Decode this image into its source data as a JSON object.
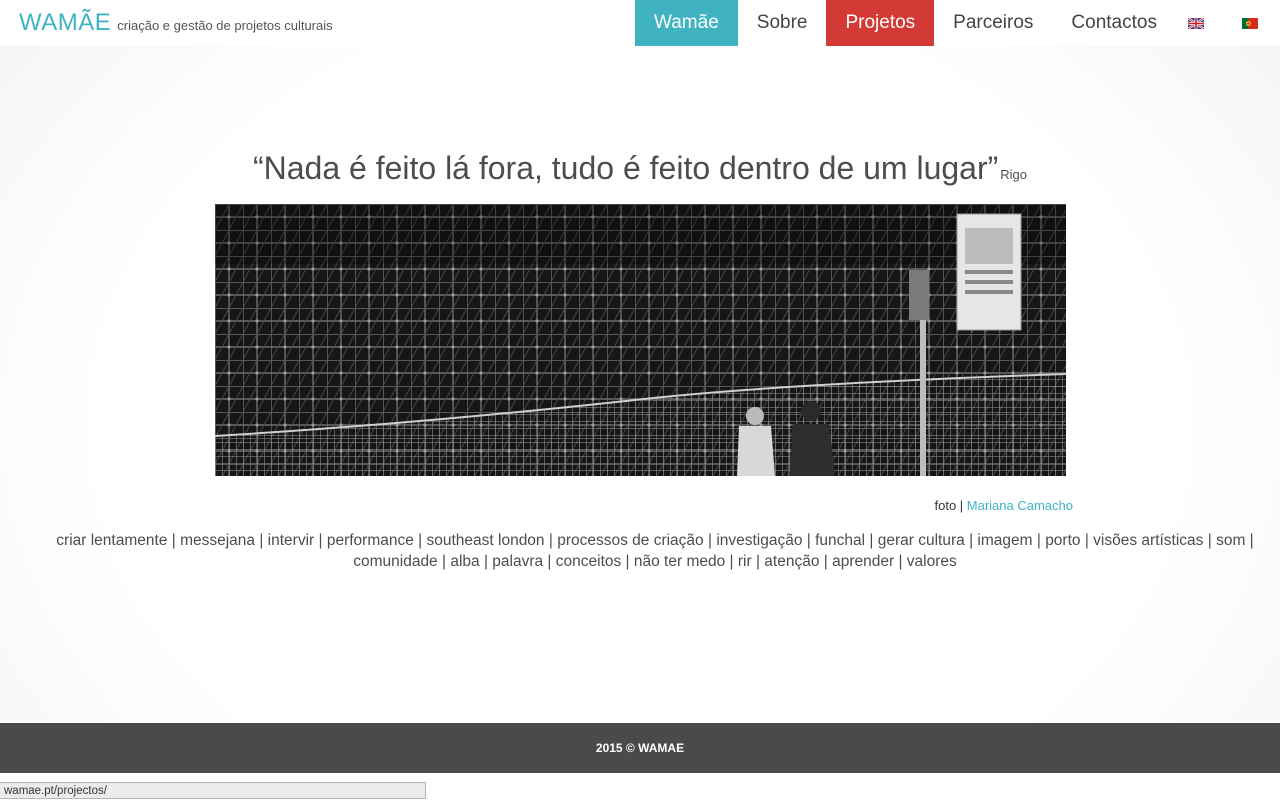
{
  "header": {
    "brand": "WAMÃE",
    "tagline": "criação e gestão de projetos culturais",
    "nav": [
      {
        "label": "Wamãe",
        "style": "teal"
      },
      {
        "label": "Sobre",
        "style": "plain"
      },
      {
        "label": "Projetos",
        "style": "red"
      },
      {
        "label": "Parceiros",
        "style": "plain"
      },
      {
        "label": "Contactos",
        "style": "plain"
      }
    ],
    "flags": [
      "uk-flag-icon",
      "pt-flag-icon"
    ]
  },
  "main": {
    "quote": "“Nada é feito lá fora, tudo é feito dentro de um lugar”",
    "quote_author": "Rigo",
    "credit_prefix": "foto | ",
    "credit_name": "Mariana Camacho",
    "tags": [
      "criar lentamente",
      "messejana",
      "intervir",
      "performance",
      "southeast london",
      "processos de criação",
      "investigação",
      "funchal",
      "gerar cultura",
      "imagem",
      "porto",
      "visões artísticas",
      "som",
      "comunidade",
      "alba",
      "palavra",
      "conceitos",
      "não ter medo",
      "rir",
      "atenção",
      "aprender",
      "valores"
    ]
  },
  "footer": {
    "copyright": "2015 © WAMAE"
  },
  "statusbar": {
    "url": "wamae.pt/projectos/"
  },
  "colors": {
    "accent": "#3fb3c1",
    "active": "#d43a35",
    "footer_bg": "#4a4a4a"
  }
}
